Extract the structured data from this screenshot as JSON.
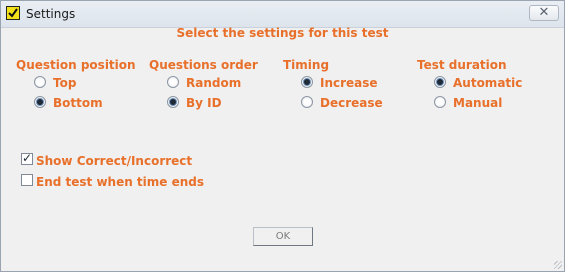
{
  "window": {
    "title": "Settings",
    "close_symbol": "✕"
  },
  "heading": "Select the settings for this test",
  "groups": [
    {
      "label": "Question position",
      "options": [
        {
          "label": "Top",
          "selected": false
        },
        {
          "label": "Bottom",
          "selected": true
        }
      ]
    },
    {
      "label": "Questions order",
      "options": [
        {
          "label": "Random",
          "selected": false
        },
        {
          "label": "By ID",
          "selected": true
        }
      ]
    },
    {
      "label": "Timing",
      "options": [
        {
          "label": "Increase",
          "selected": true
        },
        {
          "label": "Decrease",
          "selected": false
        }
      ]
    },
    {
      "label": "Test duration",
      "options": [
        {
          "label": "Automatic",
          "selected": true
        },
        {
          "label": "Manual",
          "selected": false
        }
      ]
    }
  ],
  "checkboxes": [
    {
      "label": "Show Correct/Incorrect",
      "checked": true
    },
    {
      "label": "End test when time ends",
      "checked": false
    }
  ],
  "ok_label": "OK",
  "colors": {
    "accent": "#e8702a",
    "window_bg": "#f0f0f0"
  }
}
